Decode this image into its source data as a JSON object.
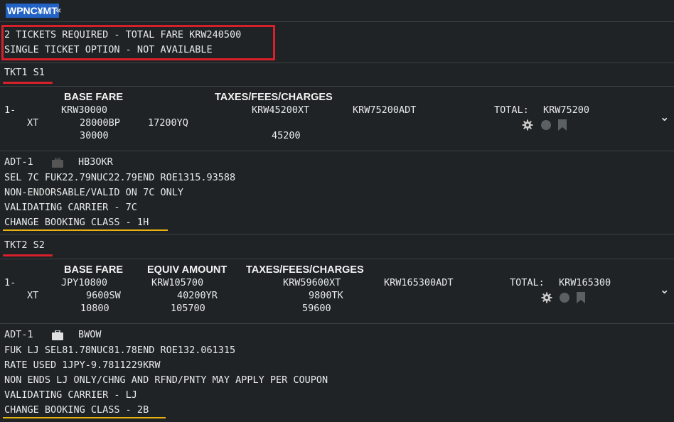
{
  "command": {
    "text": "WPNC¥MT",
    "arrow": "«"
  },
  "summary": {
    "line1": "2 TICKETS REQUIRED - TOTAL FARE KRW240500",
    "line2": "SINGLE TICKET OPTION - NOT AVAILABLE"
  },
  "ticket1": {
    "header": "TKT1 S1",
    "col_base_fare": "BASE FARE",
    "col_taxes": "TAXES/FEES/CHARGES",
    "row_index": "1-",
    "base_fare": "KRW30000",
    "taxes": "KRW45200XT",
    "adt_total": "KRW75200ADT",
    "total_label": "TOTAL:",
    "total_value": "KRW75200",
    "xt_label": "XT",
    "xt1": "28000BP",
    "xt2": "17200YQ",
    "sub_base": "30000",
    "sub_taxes": "45200",
    "details": {
      "pax": "ADT-1",
      "fare_basis": "HB3OKR",
      "calc": "SEL 7C FUK22.79NUC22.79END ROE1315.93588",
      "endorse": "NON-ENDORSABLE/VALID ON 7C ONLY",
      "validating": "VALIDATING CARRIER - 7C",
      "change_class": "CHANGE BOOKING CLASS - 1H"
    },
    "icons": {
      "gear": "gear-icon",
      "dot": "circle-icon",
      "bookmark": "bookmark-icon",
      "bag": "baggage-icon",
      "chevron": "chevron-down-icon"
    }
  },
  "ticket2": {
    "header": "TKT2 S2",
    "col_base_fare": "BASE FARE",
    "col_equiv": "EQUIV AMOUNT",
    "col_taxes": "TAXES/FEES/CHARGES",
    "row_index": "1-",
    "base_fare": "JPY10800",
    "equiv": "KRW105700",
    "taxes": "KRW59600XT",
    "adt_total": "KRW165300ADT",
    "total_label": "TOTAL:",
    "total_value": "KRW165300",
    "xt_label": "XT",
    "xt1": "9600SW",
    "xt2": "40200YR",
    "xt3": "9800TK",
    "sub_base": "10800",
    "sub_equiv": "105700",
    "sub_taxes": "59600",
    "details": {
      "pax": "ADT-1",
      "fare_basis": "BWOW",
      "calc": "FUK LJ SEL81.78NUC81.78END ROE132.061315",
      "rate": "RATE USED 1JPY-9.7811229KRW",
      "endorse": "NON ENDS LJ ONLY/CHNG AND RFND/PNTY MAY APPLY PER COUPON",
      "validating": "VALIDATING CARRIER - LJ",
      "change_class": "CHANGE BOOKING CLASS - 2B"
    }
  },
  "colors": {
    "background": "#1f2325",
    "highlight": "#2463c6",
    "red": "#d8202a",
    "yellow": "#e8b310"
  }
}
